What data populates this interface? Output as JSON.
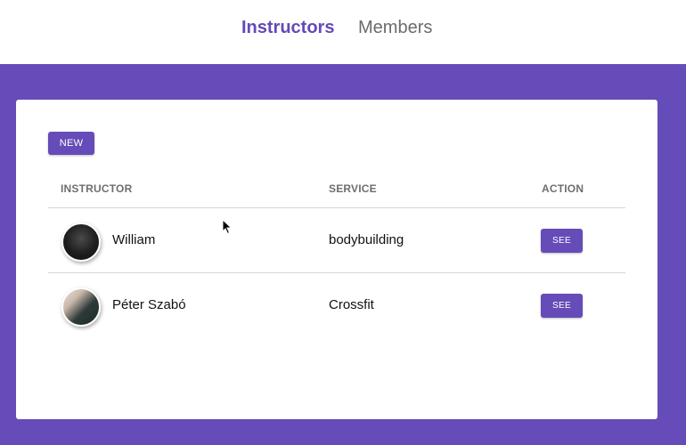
{
  "nav": {
    "tabs": [
      {
        "label": "Instructors",
        "active": true
      },
      {
        "label": "Members",
        "active": false
      }
    ]
  },
  "toolbar": {
    "new_label": "NEW"
  },
  "table": {
    "columns": [
      "INSTRUCTOR",
      "SERVICE",
      "ACTION"
    ],
    "rows": [
      {
        "name": "William",
        "service": "bodybuilding",
        "action": "SEE",
        "avatar": "instructor-photo"
      },
      {
        "name": "Péter Szabó",
        "service": "Crossfit",
        "action": "SEE",
        "avatar": "instructor-photo"
      }
    ]
  },
  "colors": {
    "accent": "#654cb8",
    "background_band": "#654cb8",
    "inactive_tab": "#6b6b6b",
    "header_text": "#6e6e6e"
  }
}
